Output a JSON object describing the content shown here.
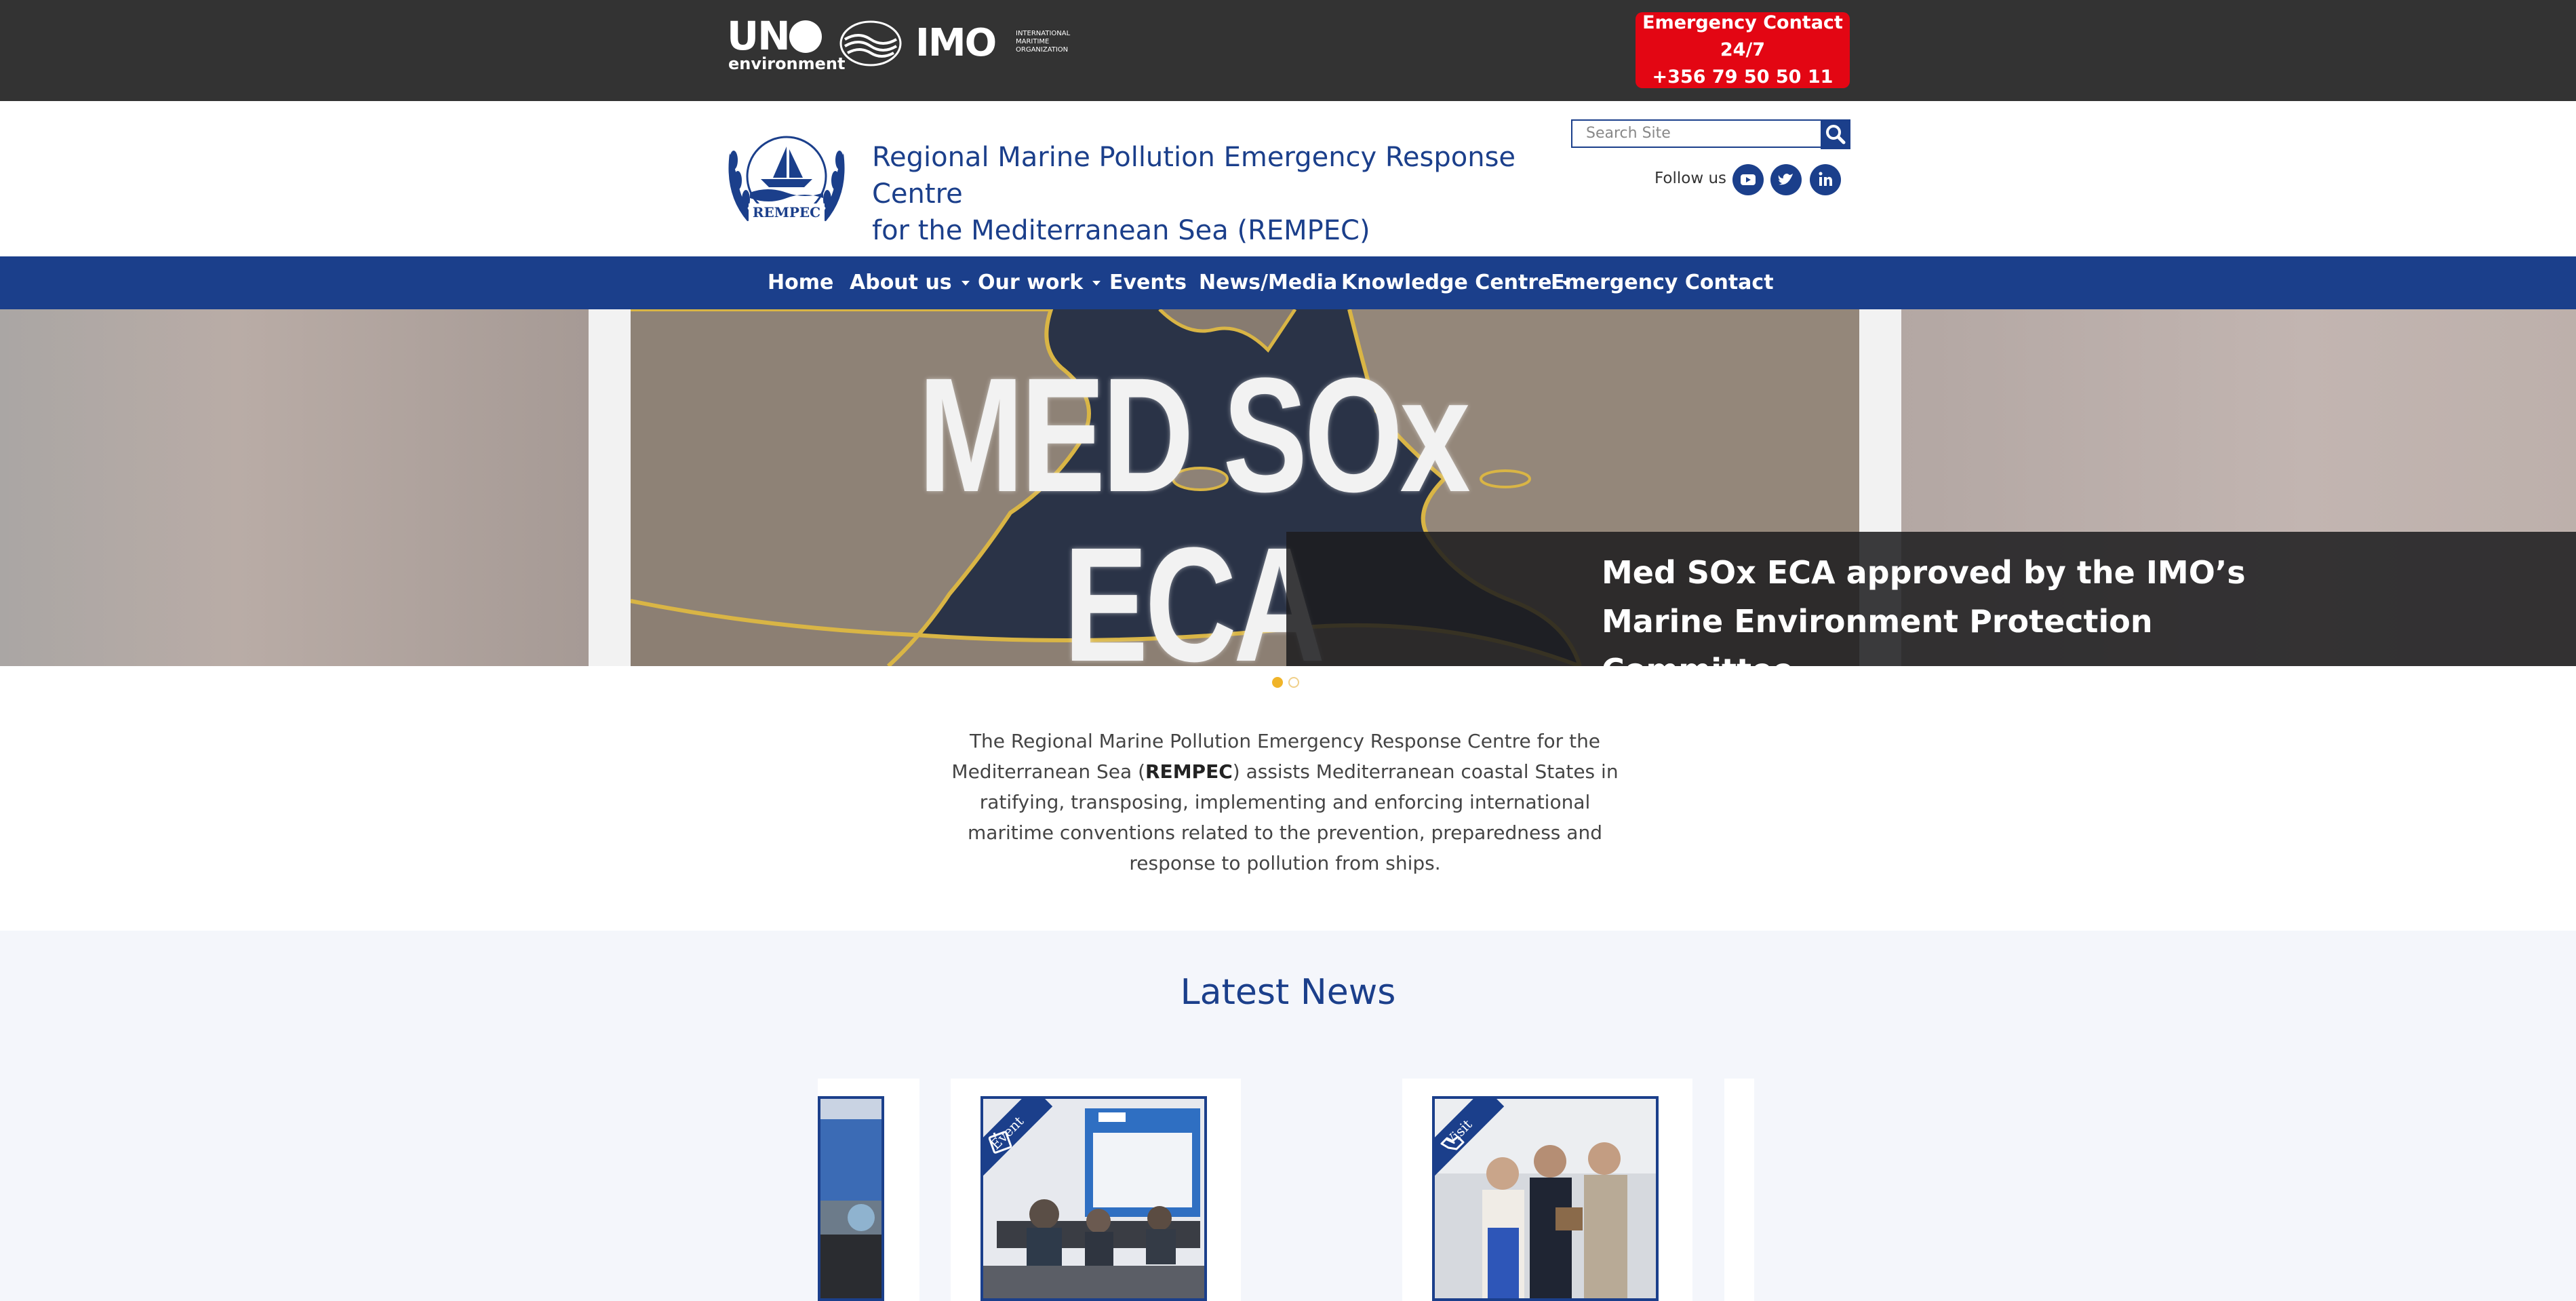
{
  "topbar": {
    "logos": {
      "un_text": "UN",
      "un_sub": "environment",
      "imo_text": "IMO",
      "imo_full": "INTERNATIONAL MARITIME ORGANIZATION"
    },
    "emergency": {
      "line1": "Emergency Contact 24/7",
      "line2": "+356 79 50 50 11"
    }
  },
  "header": {
    "logo_text": "REMPEC",
    "title_line1": "Regional Marine Pollution Emergency Response Centre",
    "title_line2": "for the Mediterranean Sea (REMPEC)",
    "search_placeholder": "Search Site",
    "follow_label": "Follow us"
  },
  "nav": {
    "items": [
      {
        "label": "Home",
        "dropdown": false
      },
      {
        "label": "About us",
        "dropdown": true
      },
      {
        "label": "Our work",
        "dropdown": true
      },
      {
        "label": "Events",
        "dropdown": false
      },
      {
        "label": "News/Media",
        "dropdown": false
      },
      {
        "label": "Knowledge Centre",
        "dropdown": true
      },
      {
        "label": "Emergency Contact",
        "dropdown": false
      }
    ]
  },
  "hero": {
    "image_text": "MED SOx ECA",
    "caption": "Med SOx ECA approved by the IMO’s Marine Environment Protection Committee",
    "slide_count": 2,
    "active_slide": 1
  },
  "intro": {
    "before": "The Regional Marine Pollution Emergency Response Centre for the Mediterranean Sea (",
    "bold": "REMPEC",
    "after": ") assists Mediterranean coastal States in ratifying, transposing, implementing and enforcing international maritime conventions related to the prevention, preparedness and response to pollution from ships."
  },
  "news": {
    "heading": "Latest News",
    "cards": [
      {
        "ribbon": ""
      },
      {
        "ribbon": "Event"
      },
      {
        "ribbon": "Visit"
      }
    ]
  },
  "colors": {
    "brand_blue": "#1b3f8b",
    "emergency_red": "#e30613",
    "topbar": "#333333",
    "dot_active": "#f0b429"
  }
}
